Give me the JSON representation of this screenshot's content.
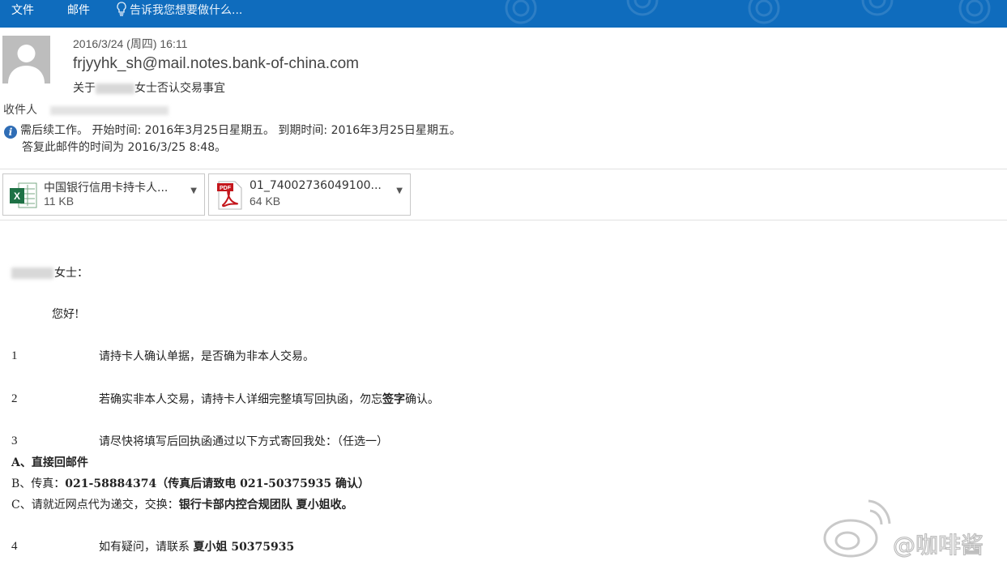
{
  "ribbon": {
    "file_tab": "文件",
    "mail_tab": "邮件",
    "tell_me": "告诉我您想要做什么..."
  },
  "header": {
    "date": "2016/3/24 (周四) 16:11",
    "sender": "frjyyhk_sh@mail.notes.bank-of-china.com",
    "subject_prefix": "关于",
    "subject_suffix": "女士否认交易事宜",
    "to_label": "收件人"
  },
  "info": {
    "line1": "需后续工作。  开始时间: 2016年3月25日星期五。  到期时间: 2016年3月25日星期五。",
    "line2": "答复此邮件的时间为 2016/3/25 8:48。"
  },
  "attachments": [
    {
      "name": "中国银行信用卡持卡人...",
      "size": "11 KB",
      "type": "excel-icon"
    },
    {
      "name": "01_74002736049100...",
      "size": "64 KB",
      "type": "pdf-icon",
      "badge": "PDF"
    }
  ],
  "body": {
    "greeting_suffix": "女士：",
    "hello": "您好!",
    "items": [
      {
        "num": "1",
        "text": "请持卡人确认单据，是否确为非本人交易。"
      },
      {
        "num": "2",
        "text_a": "若确实非本人交易，请持卡人详细完整填写回执函，勿忘",
        "text_b": "签字",
        "text_c": "确认。"
      },
      {
        "num": "3",
        "text": "请尽快将填写后回执函通过以下方式寄回我处：（任选一）"
      },
      {
        "num": "4",
        "text_a": "如有疑问，请联系 ",
        "text_b": "夏小姐 50375935"
      }
    ],
    "option_a": "A、直接回邮件",
    "option_b_label": "B、传真：",
    "option_b_value": "021-58884374（传真后请致电 021-50375935 确认）",
    "option_c_label": "C、请就近网点代为递交，交换：",
    "option_c_value": "银行卡部内控合规团队 夏小姐收。"
  },
  "watermark": {
    "text": "@咖啡酱"
  }
}
